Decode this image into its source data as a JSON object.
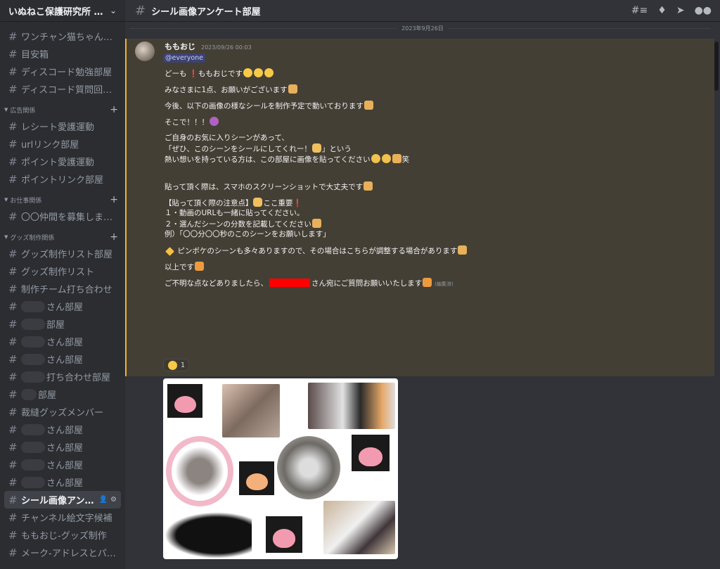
{
  "server": {
    "name": "いぬねこ保護研究所 by ..."
  },
  "sidebar": {
    "top_items": [
      {
        "label": "ワンチャン猫ちゃんの..."
      },
      {
        "label": "目安箱"
      },
      {
        "label": "ディスコード勉強部屋"
      },
      {
        "label": "ディスコード質問回答集"
      }
    ],
    "categories": [
      {
        "label": "広告関係",
        "items": [
          {
            "label": "レシート愛護運動"
          },
          {
            "label": "urlリンク部屋"
          },
          {
            "label": "ポイント愛護運動"
          },
          {
            "label": "ポイントリンク部屋"
          }
        ]
      },
      {
        "label": "お仕事関係",
        "items": [
          {
            "label": "〇〇仲間を募集します♪"
          }
        ]
      },
      {
        "label": "グッズ制作関係",
        "items": [
          {
            "label": "グッズ制作リスト部屋"
          },
          {
            "label": "グッズ制作リスト"
          },
          {
            "label": "制作チーム打ち合わせ"
          },
          {
            "label": "さん部屋"
          },
          {
            "label": "部屋"
          },
          {
            "label": "さん部屋"
          },
          {
            "label": "さん部屋"
          },
          {
            "label": "打ち合わせ部屋"
          },
          {
            "label": "部屋"
          },
          {
            "label": "裁縫グッズメンバー"
          },
          {
            "label": "さん部屋"
          },
          {
            "label": "さん部屋"
          },
          {
            "label": "さん部屋"
          },
          {
            "label": "さん部屋"
          },
          {
            "label": "シール画像アンケ..."
          },
          {
            "label": "チャンネル絵文字候補"
          },
          {
            "label": "ももおじ-グッズ制作"
          },
          {
            "label": "メーク-アドレスとパス..."
          }
        ]
      }
    ]
  },
  "channel": {
    "title": "シール画像アンケート部屋"
  },
  "date_divider": "2023年9月26日",
  "message": {
    "author": "ももおじ",
    "timestamp": "2023/09/26 00:03",
    "mention": "@everyone",
    "lines": {
      "l1a": "どーも",
      "l1b": "ももおじです",
      "l2": "みなさまに1点、お願いがございます",
      "l3": "今後、以下の画像の様なシールを制作予定で動いております",
      "l4": "そこで！！！",
      "l5": "ご自身のお気に入りシーンがあって、",
      "l6a": "「ぜひ、このシーンをシールにしてくれー！",
      "l6b": "」という",
      "l7a": "熱い想いを持っている方は、この部屋に画像を貼ってください",
      "l7b": "笑",
      "l8": "貼って頂く際は、スマホのスクリーンショットで大丈夫です",
      "l9a": "【貼って頂く際の注意点】",
      "l9b": "ここ重要",
      "l10": "１・動画のURLも一緒に貼ってください。",
      "l11": "２・選んだシーンの分数を記載してください",
      "l12": "例）「〇〇分〇〇秒のこのシーンをお願いします」",
      "l13": "ピンボケのシーンも多々ありますので、その場合はこちらが調整する場合があります",
      "l14": "以上です",
      "l15a": "ご不明な点などありましたら、",
      "l15b": "さん宛にご質問お願いいたします",
      "edited": "(編集済)"
    },
    "reaction_count": "1"
  },
  "colors": {
    "accent_bar": "#f0b232",
    "highlight_bg": "#443f35",
    "redaction": "#ff0000"
  },
  "icons": [
    "threads-icon",
    "bell-icon",
    "pin-icon",
    "members-icon"
  ]
}
